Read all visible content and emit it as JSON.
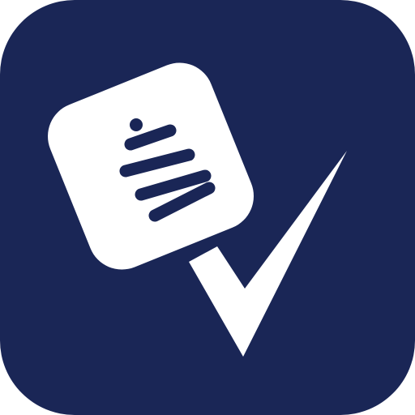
{
  "icon": {
    "name": "microphone-checkmark-app-icon",
    "background_color": "#1a2656",
    "foreground_color": "#ffffff",
    "glyphs": [
      "microphone-icon",
      "checkmark-icon"
    ]
  }
}
